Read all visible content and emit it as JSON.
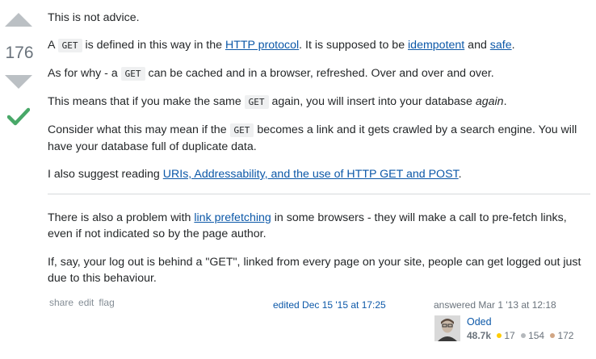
{
  "vote": {
    "count": "176",
    "accepted_color": "#48a868"
  },
  "post": {
    "p1": "This is not advice.",
    "p2": {
      "t1": "A ",
      "code": "GET",
      "t2": " is defined in this way in the ",
      "link1": "HTTP protocol",
      "t3": ". It is supposed to be ",
      "link2": "idempotent",
      "t4": " and ",
      "link3": "safe",
      "t5": "."
    },
    "p3": {
      "t1": "As for why - a ",
      "code": "GET",
      "t2": " can be cached and in a browser, refreshed. Over and over and over."
    },
    "p4": {
      "t1": "This means that if you make the same ",
      "code": "GET",
      "t2": " again, you will insert into your database ",
      "em": "again",
      "t3": "."
    },
    "p5": {
      "t1": "Consider what this may mean if the ",
      "code": "GET",
      "t2": " becomes a link and it gets crawled by a search engine. You will have your database full of duplicate data."
    },
    "p6": {
      "t1": "I also suggest reading ",
      "link": "URIs, Addressability, and the use of HTTP GET and POST",
      "t2": "."
    },
    "p7": {
      "t1": "There is also a problem with ",
      "link": "link prefetching",
      "t2": " in some browsers - they will make a call to pre-fetch links, even if not indicated so by the page author."
    },
    "p8": "If, say, your log out is behind a \"GET\", linked from every page on your site, people can get logged out just due to this behaviour."
  },
  "menu": {
    "share": "share",
    "edit": "edit",
    "flag": "flag"
  },
  "edited": "edited Dec 15 '15 at 17:25",
  "answered": "answered Mar 1 '13 at 12:18",
  "user": {
    "name": "Oded",
    "reputation": "48.7k",
    "gold": "17",
    "silver": "154",
    "bronze": "172",
    "gold_color": "#ffcc01",
    "silver_color": "#b4b8bc",
    "bronze_color": "#d1a684"
  }
}
